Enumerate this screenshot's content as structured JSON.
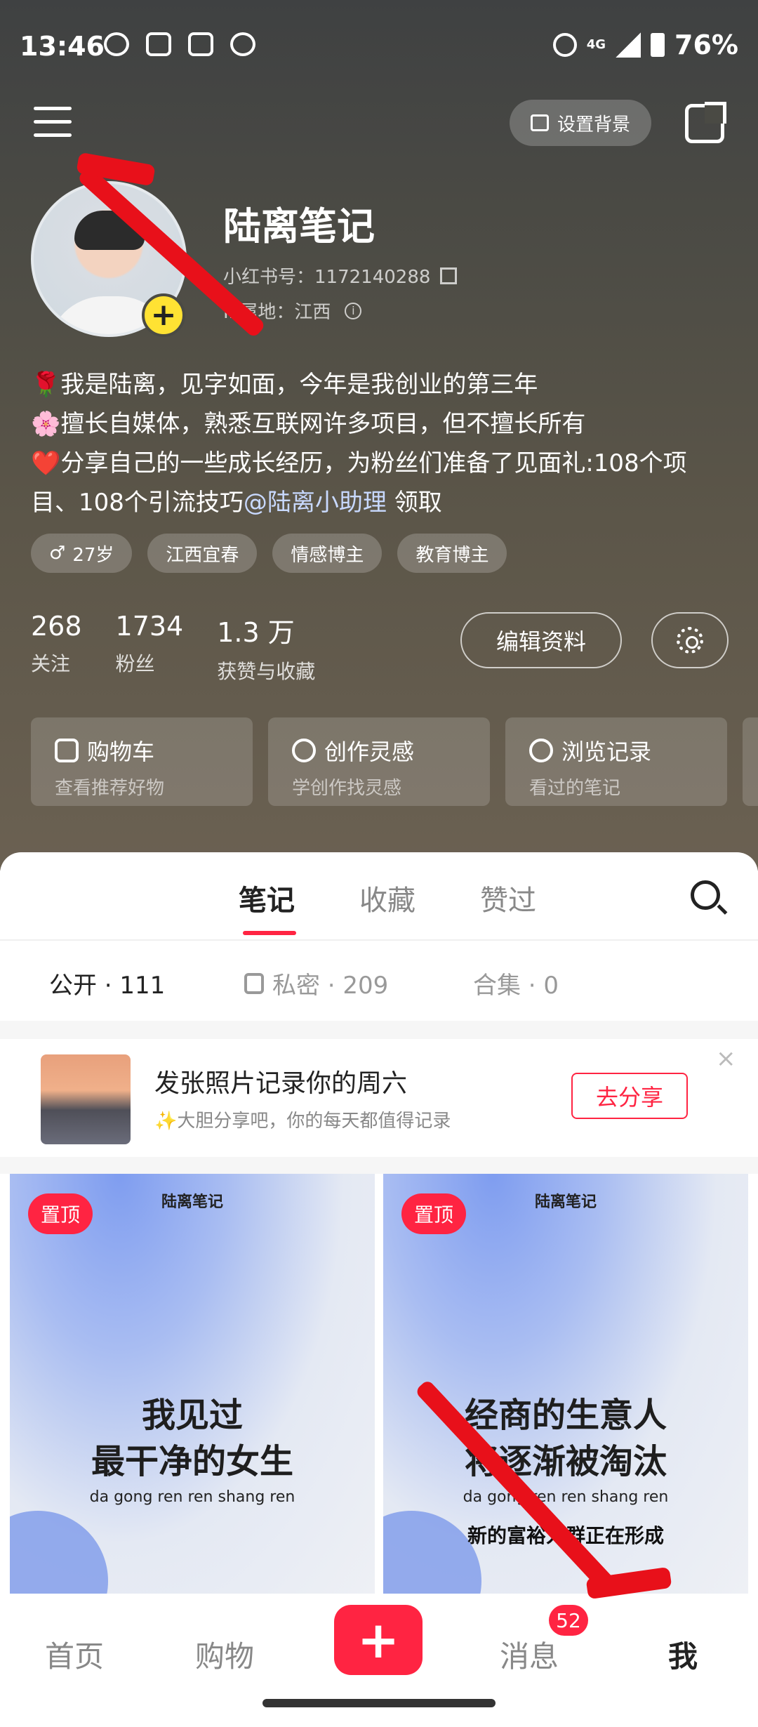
{
  "status_bar": {
    "time": "13:46",
    "network": "4G",
    "battery": "76%"
  },
  "top_bar": {
    "set_background_label": "设置背景"
  },
  "profile": {
    "name": "陆离笔记",
    "id_text": "小红书号：1172140288",
    "location_text": "IP属地：江西",
    "bio_lines": [
      "🌹我是陆离，见字如面，今年是我创业的第三年",
      "🌸擅长自媒体，熟悉互联网许多项目，但不擅长所有",
      "❤️分享自己的一些成长经历，为粉丝们准备了见面礼:108个项目、108个引流技巧"
    ],
    "bio_link": "@陆离小助理",
    "bio_tail": " 领取",
    "tags": [
      "27岁",
      "江西宜春",
      "情感博主",
      "教育博主"
    ]
  },
  "stats": [
    {
      "value": "268",
      "label": "关注"
    },
    {
      "value": "1734",
      "label": "粉丝"
    },
    {
      "value": "1.3 万",
      "label": "获赞与收藏"
    }
  ],
  "edit_profile_label": "编辑资料",
  "shortcuts": [
    {
      "title": "购物车",
      "subtitle": "查看推荐好物",
      "icon": "cart-icon"
    },
    {
      "title": "创作灵感",
      "subtitle": "学创作找灵感",
      "icon": "bulb-icon"
    },
    {
      "title": "浏览记录",
      "subtitle": "看过的笔记",
      "icon": "clock-icon"
    }
  ],
  "tabs": [
    "笔记",
    "收藏",
    "赞过"
  ],
  "subtabs": {
    "public": "公开 · 111",
    "private": "私密 · 209",
    "collection": "合集 · 0"
  },
  "prompt": {
    "title": "发张照片记录你的周六",
    "subtitle": "✨大胆分享吧，你的每天都值得记录",
    "button": "去分享",
    "close": "×"
  },
  "notes": [
    {
      "badge": "置顶",
      "brand": "陆离笔记",
      "line1": "我见过",
      "line2": "最干净的女生",
      "pinyin": "da gong ren  ren shang ren",
      "small": ""
    },
    {
      "badge": "置顶",
      "brand": "陆离笔记",
      "line1": "经商的生意人",
      "line2": "将逐渐被淘汰",
      "pinyin": "da gong ren  ren shang ren",
      "small": "新的富裕人群正在形成"
    }
  ],
  "bottom_nav": {
    "home": "首页",
    "shop": "购物",
    "add": "+",
    "messages": "消息",
    "messages_badge": "52",
    "me": "我"
  },
  "colors": {
    "accent": "#ff2442",
    "header_bg": "#4d4c45"
  }
}
